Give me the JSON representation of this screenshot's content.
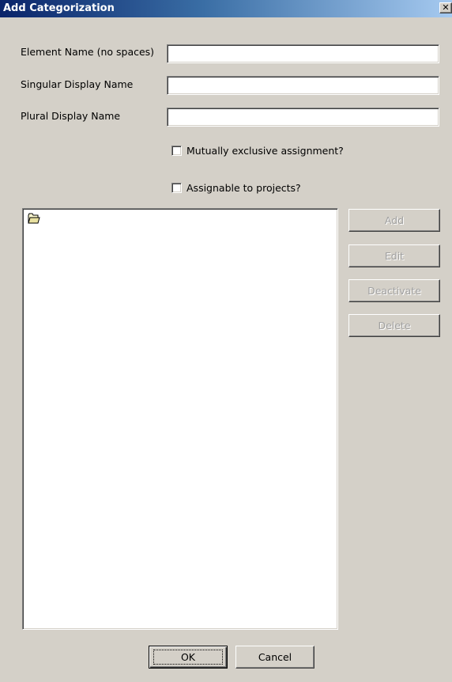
{
  "window": {
    "title": "Add Categorization",
    "close_glyph": "✕"
  },
  "form": {
    "element_name_label": "Element Name (no spaces)",
    "element_name_value": "",
    "singular_label": "Singular Display Name",
    "singular_value": "",
    "plural_label": "Plural Display Name",
    "plural_value": ""
  },
  "options": {
    "mutually_exclusive_label": "Mutually exclusive assignment?",
    "mutually_exclusive_checked": false,
    "assignable_label": "Assignable to projects?",
    "assignable_checked": false
  },
  "tree": {
    "root_icon": "folder-icon"
  },
  "side_buttons": {
    "add": "Add",
    "edit": "Edit",
    "deactivate": "Deactivate",
    "delete": "Delete",
    "disabled_color": "#a0a0a0"
  },
  "footer": {
    "ok": "OK",
    "cancel": "Cancel"
  },
  "colors": {
    "titlebar_start": "#0a246a",
    "titlebar_end": "#a6caf0",
    "dialog_bg": "#d4d0c8"
  }
}
